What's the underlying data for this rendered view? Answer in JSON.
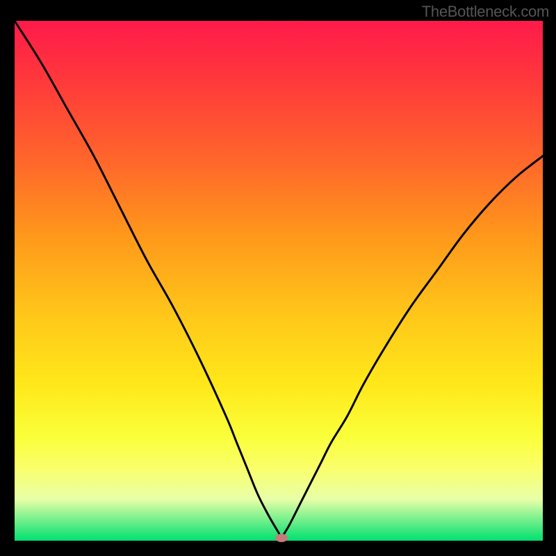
{
  "watermark": "TheBottleneck.com",
  "chart_data": {
    "type": "line",
    "title": "",
    "xlabel": "",
    "ylabel": "",
    "xlim": [
      0,
      100
    ],
    "ylim": [
      0,
      100
    ],
    "series": [
      {
        "name": "left-branch",
        "x": [
          0,
          5,
          10,
          15,
          20,
          25,
          30,
          35,
          40,
          42,
          44,
          46,
          48,
          50,
          50.5
        ],
        "y": [
          100,
          92,
          83,
          74,
          64,
          54,
          45,
          35,
          24,
          19,
          14,
          9,
          5,
          1.5,
          0.5
        ]
      },
      {
        "name": "right-branch",
        "x": [
          50.5,
          52,
          54,
          56,
          58,
          60,
          63,
          66,
          70,
          75,
          80,
          85,
          90,
          95,
          100
        ],
        "y": [
          0.5,
          3,
          7,
          11,
          15,
          19,
          24,
          30,
          37,
          45,
          52,
          59,
          65,
          70,
          74
        ]
      }
    ],
    "marker": {
      "x": 50.5,
      "y": 0.5,
      "color": "#c97a7a"
    },
    "grid": false,
    "legend": false,
    "background": "sunset-gradient"
  }
}
